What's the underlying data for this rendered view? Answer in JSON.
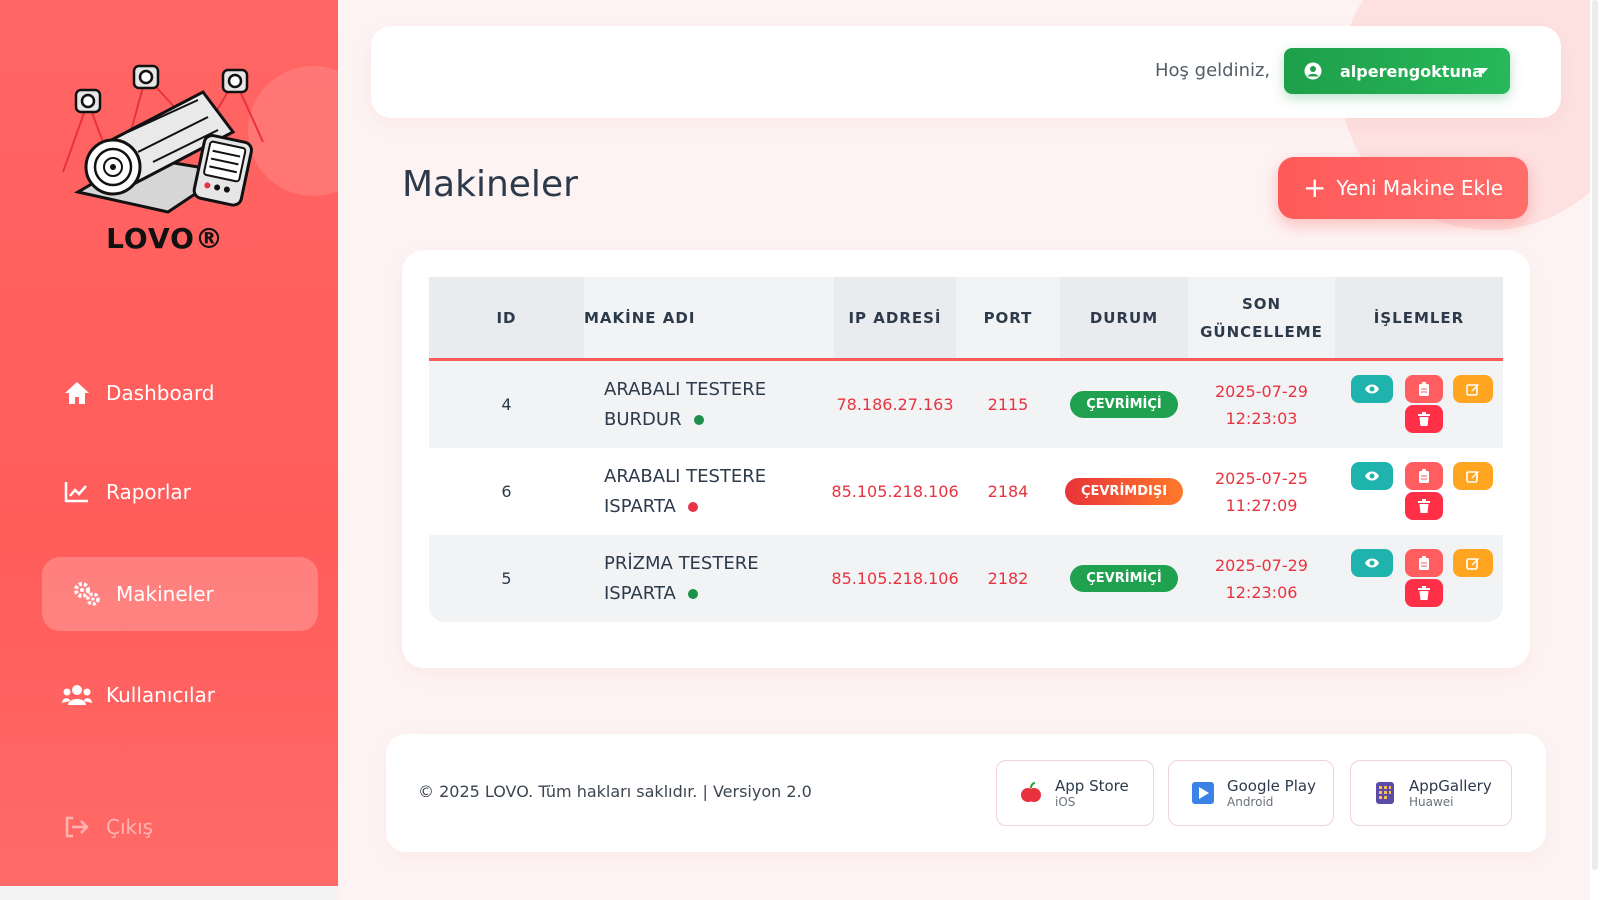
{
  "brand": {
    "logo_text": "LOVO®"
  },
  "sidebar": {
    "items": [
      {
        "label": "Dashboard",
        "icon": "home-icon"
      },
      {
        "label": "Raporlar",
        "icon": "chart-line-icon"
      },
      {
        "label": "Makineler",
        "icon": "gears-icon",
        "active": true
      },
      {
        "label": "Kullanıcılar",
        "icon": "users-icon"
      }
    ],
    "logout": {
      "label": "Çıkış",
      "icon": "sign-out-icon"
    }
  },
  "header": {
    "welcome": "Hoş geldiniz,",
    "user": "alperengoktuna"
  },
  "page": {
    "title": "Makineler",
    "add_button": "Yeni Makine Ekle"
  },
  "table": {
    "headers": {
      "id": "ID",
      "name": "MAKİNE ADI",
      "ip": "IP ADRESİ",
      "port": "PORT",
      "status": "DURUM",
      "updated_1": "SON",
      "updated_2": "GÜNCELLEME",
      "actions": "İŞLEMLER"
    },
    "rows": [
      {
        "id": "4",
        "name_1": "ARABALI TESTERE",
        "name_2": "BURDUR",
        "online": true,
        "ip": "78.186.27.163",
        "port": "2115",
        "status": "ÇEVRİMİÇİ",
        "date": "2025-07-29",
        "time": "12:23:03"
      },
      {
        "id": "6",
        "name_1": "ARABALI TESTERE",
        "name_2": "ISPARTA",
        "online": false,
        "ip": "85.105.218.106",
        "port": "2184",
        "status": "ÇEVRİMDIŞI",
        "date": "2025-07-25",
        "time": "11:27:09"
      },
      {
        "id": "5",
        "name_1": "PRİZMA TESTERE",
        "name_2": "ISPARTA",
        "online": true,
        "ip": "85.105.218.106",
        "port": "2182",
        "status": "ÇEVRİMİÇİ",
        "date": "2025-07-29",
        "time": "12:23:06"
      }
    ]
  },
  "footer": {
    "copyright": "© 2025 LOVO. Tüm hakları saklıdır. | Versiyon 2.0",
    "stores": [
      {
        "title": "App Store",
        "sub": "iOS"
      },
      {
        "title": "Google Play",
        "sub": "Android"
      },
      {
        "title": "AppGallery",
        "sub": "Huawei"
      }
    ]
  },
  "colors": {
    "sidebar": "#ff5c5a",
    "accent_red": "#e8333f",
    "online_green": "#1fa150",
    "user_button": "#1e9f4a"
  }
}
